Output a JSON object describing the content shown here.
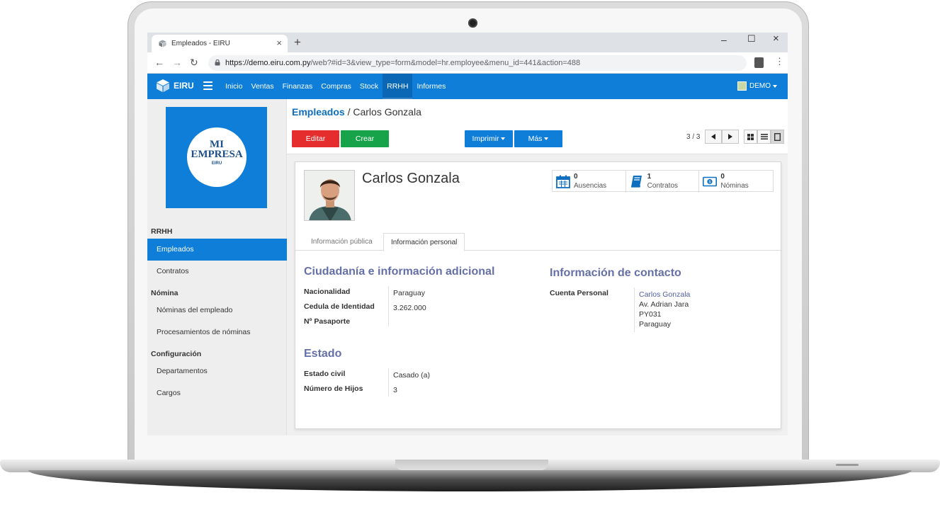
{
  "browser": {
    "tab_title": "Empleados - EIRU",
    "url_host": "https://demo.eiru.com.py",
    "url_path": "/web?#id=3&view_type=form&model=hr.employee&menu_id=441&action=488"
  },
  "navbar": {
    "brand": "EIRU",
    "menu": [
      "Inicio",
      "Ventas",
      "Finanzas",
      "Compras",
      "Stock",
      "RRHH",
      "Informes"
    ],
    "active_menu": "RRHH",
    "user": "DEMO"
  },
  "company_logo": {
    "line1": "MI",
    "line2": "EMPRESA",
    "line3": "EIRU"
  },
  "sidebar": {
    "sections": [
      {
        "title": "RRHH",
        "items": [
          "Empleados",
          "Contratos"
        ]
      },
      {
        "title": "Nómina",
        "items": [
          "Nóminas del empleado",
          "Procesamientos de nóminas"
        ]
      },
      {
        "title": "Configuración",
        "items": [
          "Departamentos",
          "Cargos"
        ]
      }
    ],
    "active_item": "Empleados"
  },
  "breadcrumb": {
    "parent": "Empleados",
    "separator": "/",
    "current": "Carlos Gonzala"
  },
  "buttons": {
    "edit": "Editar",
    "create": "Crear",
    "print": "Imprimir",
    "more": "Más"
  },
  "pager": "3 / 3",
  "employee": {
    "name": "Carlos Gonzala"
  },
  "stats": [
    {
      "count": "0",
      "label": "Ausencias",
      "icon": "calendar-icon"
    },
    {
      "count": "1",
      "label": "Contratos",
      "icon": "book-icon"
    },
    {
      "count": "0",
      "label": "Nóminas",
      "icon": "money-icon"
    }
  ],
  "tabs": [
    "Información pública",
    "Información personal"
  ],
  "active_tab": "Información personal",
  "citizenship": {
    "title": "Ciudadanía e información adicional",
    "fields": [
      {
        "label": "Nacionalidad",
        "value": "Paraguay"
      },
      {
        "label": "Cedula de Identidad",
        "value": "3.262.000"
      },
      {
        "label": "Nº Pasaporte",
        "value": ""
      }
    ]
  },
  "contact": {
    "title": "Información de contacto",
    "label": "Cuenta Personal",
    "name": "Carlos Gonzala",
    "address": [
      "Av. Adrian Jara",
      "PY031",
      "Paraguay"
    ]
  },
  "status": {
    "title": "Estado",
    "fields": [
      {
        "label": "Estado civil",
        "value": "Casado (a)"
      },
      {
        "label": "Número de Hijos",
        "value": "3"
      }
    ]
  },
  "colors": {
    "primary": "#0e7ed8",
    "edit": "#e52d2d",
    "create": "#16a34a",
    "section_title": "#6670a8"
  }
}
